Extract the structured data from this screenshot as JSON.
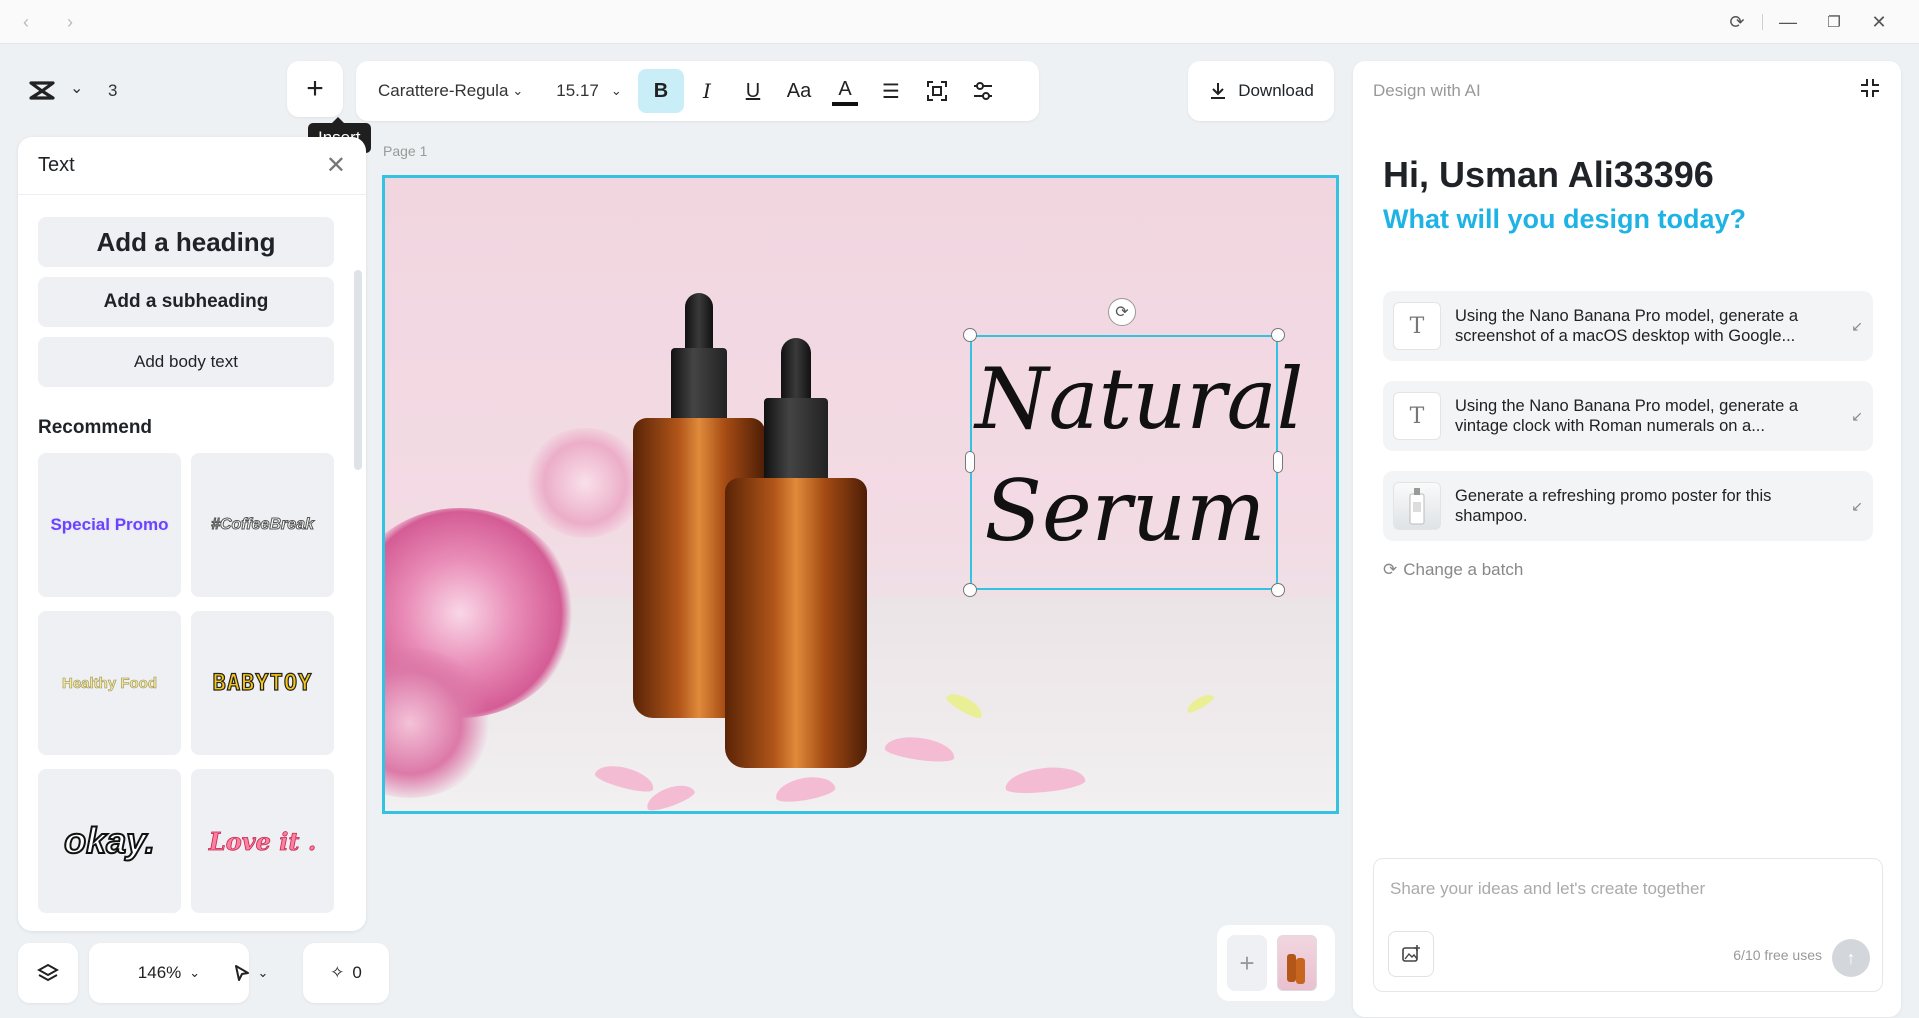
{
  "project": {
    "page_count": "3"
  },
  "insert": {
    "label": "+",
    "tooltip": "Insert"
  },
  "toolbar": {
    "font": "Carattere-Regula",
    "font_size": "15.17",
    "bold": "B",
    "italic": "I",
    "underline": "U",
    "case": "Aa",
    "color_letter": "A"
  },
  "download": {
    "label": "Download"
  },
  "text_panel": {
    "title": "Text",
    "add_heading": "Add a heading",
    "add_subheading": "Add a subheading",
    "add_body": "Add body text",
    "recommend_title": "Recommend",
    "styles": [
      "Special Promo",
      "#CoffeeBreak",
      "Healthy Food",
      "BABYTOY",
      "okay.",
      "Love it ."
    ]
  },
  "canvas": {
    "page_label": "Page 1",
    "selected_text_line1": "Natural",
    "selected_text_line2": "Serum"
  },
  "bottom": {
    "zoom": "146%",
    "ai_count": "0",
    "add_page": "+"
  },
  "ai_panel": {
    "header": "Design with AI",
    "greeting": "Hi, Usman Ali33396",
    "question": "What will you design today?",
    "suggestions": [
      {
        "icon": "T",
        "text": "Using the Nano Banana Pro model, generate a screenshot of a macOS desktop with Google..."
      },
      {
        "icon": "T",
        "text": "Using the Nano Banana Pro model, generate a vintage clock with Roman numerals on a..."
      },
      {
        "icon": "",
        "text": "Generate a refreshing promo poster for this shampoo."
      }
    ],
    "change_batch": "Change a batch",
    "input_placeholder": "Share your ideas and let's create together",
    "free_uses": "6/10 free uses"
  },
  "colors": {
    "accent": "#33c3e0",
    "ai_question": "#1eb3e4",
    "bold_active": "#c9eef8"
  }
}
